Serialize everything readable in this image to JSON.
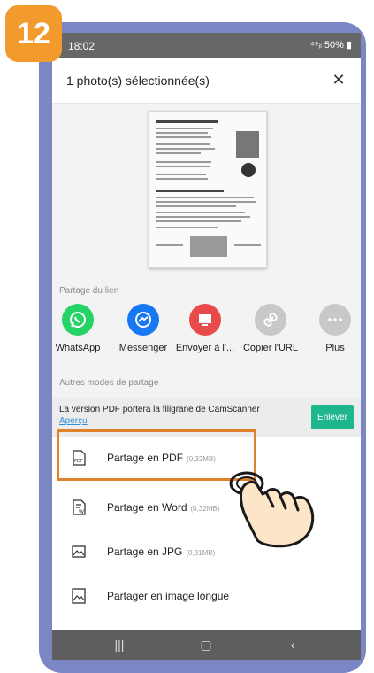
{
  "step_badge": "12",
  "status_bar": {
    "time": "18:02",
    "signal": "⁴⁹ᵢₗ",
    "battery": "50%"
  },
  "header": {
    "title": "1 photo(s) sélectionnée(s)",
    "close_icon": "close-icon"
  },
  "share_link": {
    "label": "Partage du lien",
    "items": [
      {
        "label": "WhatsApp",
        "icon": "whatsapp-icon",
        "color": "#25d366"
      },
      {
        "label": "Messenger",
        "icon": "messenger-icon",
        "color": "#1877f2"
      },
      {
        "label": "Envoyer à l'...",
        "icon": "send-to-pc-icon",
        "color": "#e84a4a"
      },
      {
        "label": "Copier l'URL",
        "icon": "link-icon",
        "color": "#c8c8c8"
      },
      {
        "label": "Plus",
        "icon": "more-icon",
        "color": "#c8c8c8"
      }
    ]
  },
  "other_share": {
    "label": "Autres modes de partage",
    "notice_text": "La version PDF portera la filigrane de CamScanner",
    "notice_link": "Aperçu",
    "notice_button": "Enlever",
    "items": [
      {
        "label": "Partage en PDF",
        "size": "(0,32MB)",
        "icon": "pdf-icon"
      },
      {
        "label": "Partage en Word",
        "size": "(0,32MB)",
        "icon": "word-icon"
      },
      {
        "label": "Partage en JPG",
        "size": "(0,31MB)",
        "icon": "image-icon"
      },
      {
        "label": "Partager en image longue",
        "size": "",
        "icon": "long-image-icon"
      }
    ]
  },
  "colors": {
    "accent": "#1fb58d",
    "highlight": "#e0822b",
    "badge": "#f39a2d",
    "phone_frame": "#7b86c4"
  }
}
